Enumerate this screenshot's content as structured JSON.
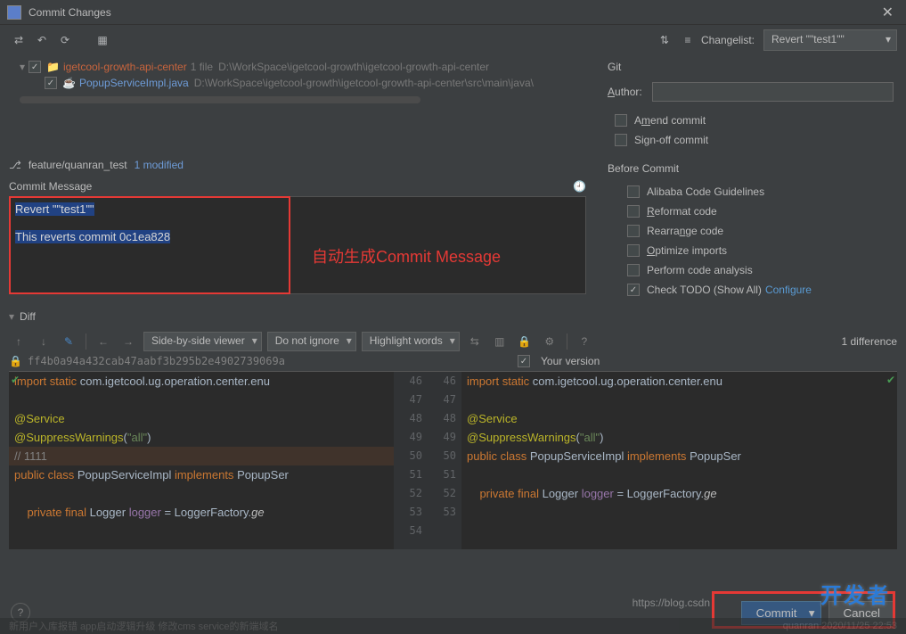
{
  "window": {
    "title": "Commit Changes"
  },
  "toolbar": {
    "changelist_label": "Changelist:",
    "changelist_value": "Revert \"\"test1\"\"",
    "git_label": "Git"
  },
  "file_tree": {
    "root": {
      "name": "igetcool-growth-api-center",
      "info": "1 file",
      "path": "D:\\WorkSpace\\igetcool-growth\\igetcool-growth-api-center"
    },
    "file": {
      "name": "PopupServiceImpl.java",
      "path": "D:\\WorkSpace\\igetcool-growth\\igetcool-growth-api-center\\src\\main\\java\\"
    }
  },
  "branch": {
    "name": "feature/quanran_test",
    "modified": "1 modified"
  },
  "commit_message": {
    "header": "Commit Message",
    "line1": "Revert \"\"test1\"\"",
    "line2": "This reverts commit 0c1ea828",
    "annotation": "自动生成Commit Message"
  },
  "git_panel": {
    "author_label": "Author:",
    "amend": "Amend commit",
    "signoff": "Sign-off commit",
    "before_commit": "Before Commit",
    "alibaba": "Alibaba Code Guidelines",
    "reformat": "Reformat code",
    "rearrange": "Rearrange code",
    "optimize": "Optimize imports",
    "analysis": "Perform code analysis",
    "todo": "Check TODO (Show All)",
    "configure": "Configure"
  },
  "diff": {
    "header": "Diff",
    "viewer": "Side-by-side viewer",
    "ignore": "Do not ignore",
    "highlight": "Highlight words",
    "count": "1 difference",
    "left_hash": "ff4b0a94a432cab47aabf3b295b2e4902739069a",
    "your_version": "Your version",
    "left_lines": [
      46,
      47,
      48,
      49,
      50,
      51,
      52,
      53,
      54
    ],
    "right_lines": [
      46,
      47,
      48,
      49,
      50,
      51,
      52,
      53
    ]
  },
  "footer": {
    "commit": "Commit",
    "cancel": "Cancel",
    "url": "https://blog.csdn",
    "watermark": "开发者",
    "strip_left": "新用户入库报错 app启动逻辑升级 修改cms service的新端域名",
    "strip_right": "quanran    2020/11/25 22:53"
  }
}
